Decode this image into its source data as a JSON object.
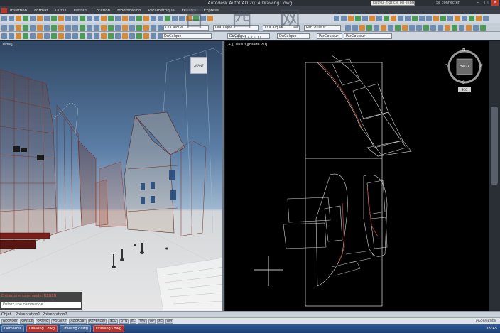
{
  "titlebar": {
    "title": "Autodesk AutoCAD 2014    Drawing1.dwg",
    "search_placeholder": "Entrez mot clé ou expression",
    "signin": "Se connecter"
  },
  "menu": [
    "Insertion",
    "Format",
    "Outils",
    "Dessin",
    "Cotation",
    "Modification",
    "Paramétrique",
    "Fenêtre",
    "Express"
  ],
  "toolbar": {
    "layer": "DuCalque",
    "linetype": "DuCalque",
    "lineweight": "DuCalque",
    "plotstyle": "ParCouleur"
  },
  "watermark": {
    "main": "百 西 网",
    "sub": "3dxy.com"
  },
  "viewport_left": {
    "label": "Défini]",
    "viewcube": "AVANT"
  },
  "viewport_right": {
    "label": "[+][Dessus][Filaire 2D]",
    "viewcube": "HAUT",
    "compass": {
      "n": "N",
      "s": "S",
      "e": "E",
      "o": "O"
    },
    "wcs": "SCG"
  },
  "command": {
    "history": "Entrez une commande: REGEN",
    "placeholder": "Entrez une commande"
  },
  "layout_tabs": [
    "Objet",
    "Présentation1",
    "Présentation2"
  ],
  "status_buttons": [
    "ACCROBJ",
    "GRILLE",
    "ORTHO",
    "POLAIRE",
    "ACCROBJ",
    "REPEROBJ",
    "SCU",
    "DYN",
    "EL",
    "TPy",
    "QP",
    "SC",
    "AM"
  ],
  "status_right": "PROPRIÉTÉS",
  "taskbar": {
    "start": "Démarrer",
    "items": [
      "Drawing1.dwg",
      "Drawing2.dwg",
      "Drawing3.dwg"
    ],
    "clock": "09:45"
  },
  "colors": {
    "model_bg": "#000000",
    "sky_top": "#2f4663",
    "accent_red": "#b8322a"
  }
}
